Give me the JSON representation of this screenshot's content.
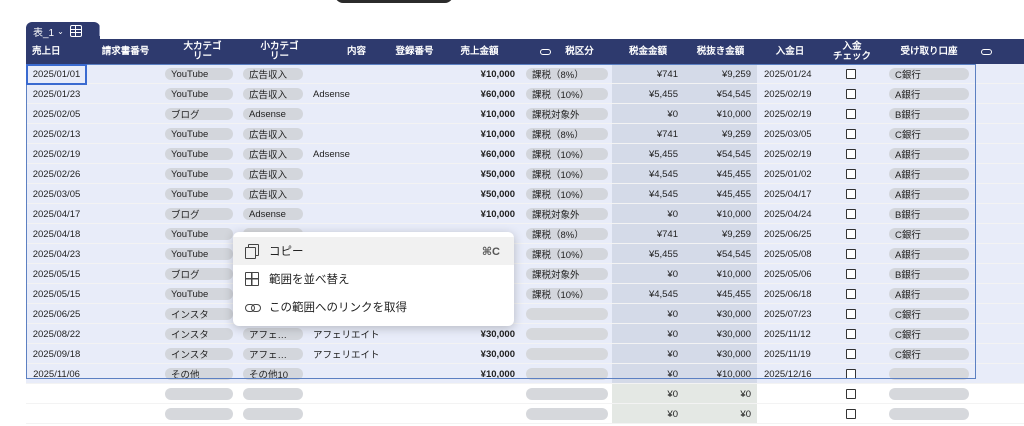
{
  "sheet_tab": {
    "label": "表_1"
  },
  "headers": [
    "売上日",
    "請求書番号",
    "大カテゴリー",
    "小カテゴリー",
    "内容",
    "登録番号",
    "売上金額",
    "税区分",
    "税金金額",
    "税抜き金額",
    "入金日",
    "入金チェック",
    "受け取り口座"
  ],
  "header_split": {
    "daikategori": [
      "大カテゴ",
      "リー"
    ],
    "shokategori": [
      "小カテゴ",
      "リー"
    ],
    "nyukincheck": [
      "入金",
      "チェック"
    ]
  },
  "rows": [
    {
      "date": "2025/01/01",
      "cat": "YouTube",
      "sub": "広告収入",
      "content": "",
      "amount": "¥10,000",
      "tax_type": "課税（8%）",
      "tax": "¥741",
      "net": "¥9,259",
      "paid_date": "2025/01/24",
      "account": "C銀行"
    },
    {
      "date": "2025/01/23",
      "cat": "YouTube",
      "sub": "広告収入",
      "content": "Adsense",
      "amount": "¥60,000",
      "tax_type": "課税（10%）",
      "tax": "¥5,455",
      "net": "¥54,545",
      "paid_date": "2025/02/19",
      "account": "A銀行"
    },
    {
      "date": "2025/02/05",
      "cat": "ブログ",
      "sub": "Adsense",
      "content": "",
      "amount": "¥10,000",
      "tax_type": "課税対象外",
      "tax": "¥0",
      "net": "¥10,000",
      "paid_date": "2025/02/19",
      "account": "B銀行"
    },
    {
      "date": "2025/02/13",
      "cat": "YouTube",
      "sub": "広告収入",
      "content": "",
      "amount": "¥10,000",
      "tax_type": "課税（8%）",
      "tax": "¥741",
      "net": "¥9,259",
      "paid_date": "2025/03/05",
      "account": "C銀行"
    },
    {
      "date": "2025/02/19",
      "cat": "YouTube",
      "sub": "広告収入",
      "content": "Adsense",
      "amount": "¥60,000",
      "tax_type": "課税（10%）",
      "tax": "¥5,455",
      "net": "¥54,545",
      "paid_date": "2025/02/19",
      "account": "A銀行"
    },
    {
      "date": "2025/02/26",
      "cat": "YouTube",
      "sub": "広告収入",
      "content": "",
      "amount": "¥50,000",
      "tax_type": "課税（10%）",
      "tax": "¥4,545",
      "net": "¥45,455",
      "paid_date": "2025/01/02",
      "account": "A銀行"
    },
    {
      "date": "2025/03/05",
      "cat": "YouTube",
      "sub": "広告収入",
      "content": "",
      "amount": "¥50,000",
      "tax_type": "課税（10%）",
      "tax": "¥4,545",
      "net": "¥45,455",
      "paid_date": "2025/04/17",
      "account": "A銀行"
    },
    {
      "date": "2025/04/17",
      "cat": "ブログ",
      "sub": "Adsense",
      "content": "",
      "amount": "¥10,000",
      "tax_type": "課税対象外",
      "tax": "¥0",
      "net": "¥10,000",
      "paid_date": "2025/04/24",
      "account": "B銀行"
    },
    {
      "date": "2025/04/18",
      "cat": "YouTube",
      "sub": "",
      "content": "",
      "amount": "",
      "tax_type": "課税（8%）",
      "tax": "¥741",
      "net": "¥9,259",
      "paid_date": "2025/06/25",
      "account": "C銀行"
    },
    {
      "date": "2025/04/23",
      "cat": "YouTube",
      "sub": "",
      "content": "",
      "amount": "",
      "tax_type": "課税（10%）",
      "tax": "¥5,455",
      "net": "¥54,545",
      "paid_date": "2025/05/08",
      "account": "A銀行"
    },
    {
      "date": "2025/05/15",
      "cat": "ブログ",
      "sub": "",
      "content": "",
      "amount": "",
      "tax_type": "課税対象外",
      "tax": "¥0",
      "net": "¥10,000",
      "paid_date": "2025/05/06",
      "account": "B銀行"
    },
    {
      "date": "2025/05/15",
      "cat": "YouTube",
      "sub": "",
      "content": "",
      "amount": "",
      "tax_type": "課税（10%）",
      "tax": "¥4,545",
      "net": "¥45,455",
      "paid_date": "2025/06/18",
      "account": "A銀行"
    },
    {
      "date": "2025/06/25",
      "cat": "インスタ",
      "sub": "",
      "content": "",
      "amount": "",
      "tax_type": "",
      "tax": "¥0",
      "net": "¥30,000",
      "paid_date": "2025/07/23",
      "account": "C銀行"
    },
    {
      "date": "2025/08/22",
      "cat": "インスタ",
      "sub": "アフェ…",
      "content": "アフェリエイト",
      "amount": "¥30,000",
      "tax_type": "",
      "tax": "¥0",
      "net": "¥30,000",
      "paid_date": "2025/11/12",
      "account": "C銀行"
    },
    {
      "date": "2025/09/18",
      "cat": "インスタ",
      "sub": "アフェ…",
      "content": "アフェリエイト",
      "amount": "¥30,000",
      "tax_type": "",
      "tax": "¥0",
      "net": "¥30,000",
      "paid_date": "2025/11/19",
      "account": "C銀行"
    },
    {
      "date": "2025/11/06",
      "cat": "その他",
      "sub": "その他10",
      "content": "",
      "amount": "¥10,000",
      "tax_type": "",
      "tax": "¥0",
      "net": "¥10,000",
      "paid_date": "2025/12/16",
      "account": ""
    }
  ],
  "empty_rows": [
    {
      "tax": "¥0",
      "net": "¥0"
    },
    {
      "tax": "¥0",
      "net": "¥0"
    }
  ],
  "context_menu": {
    "items": [
      {
        "label": "コピー",
        "shortcut": "⌘C"
      },
      {
        "label": "範囲を並べ替え",
        "shortcut": ""
      },
      {
        "label": "この範囲へのリンクを取得",
        "shortcut": ""
      }
    ]
  }
}
